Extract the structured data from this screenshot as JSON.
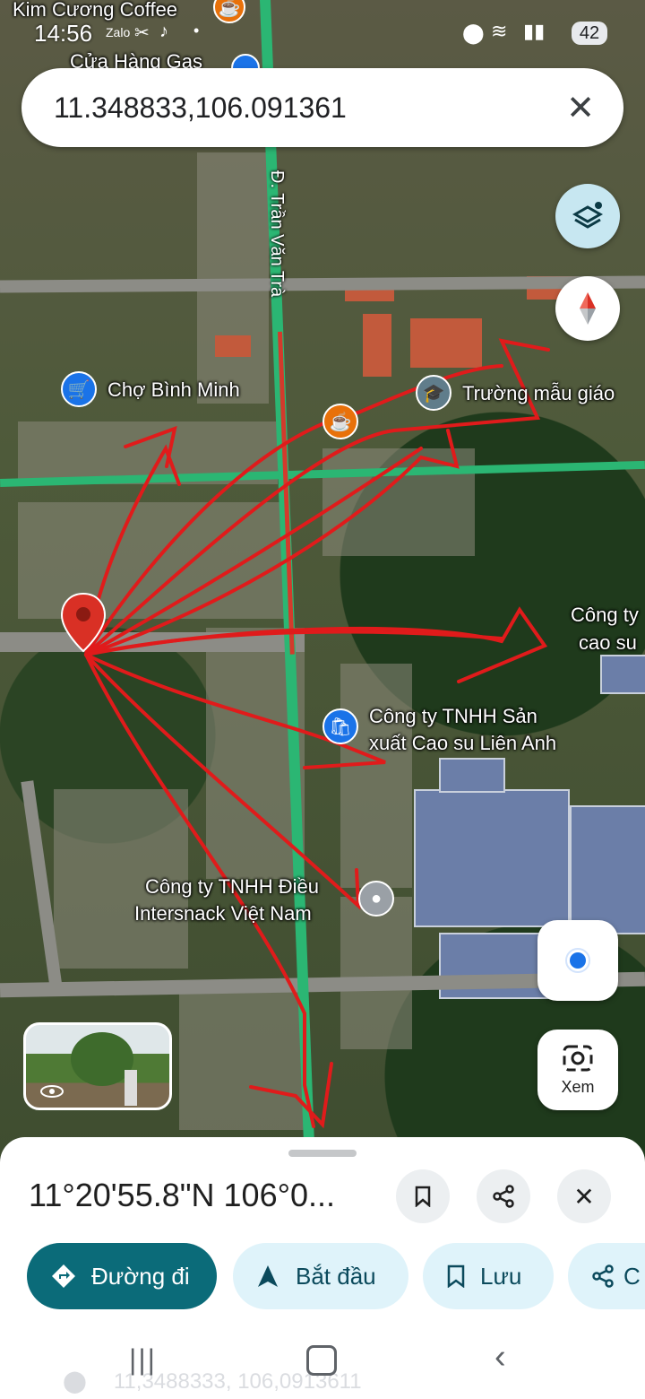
{
  "status_bar": {
    "time": "14:56",
    "battery": "42",
    "top_labels": [
      "Kim Cương Coffee",
      "Cửa Hàng Gas"
    ]
  },
  "search": {
    "value": "11.348833,106.091361"
  },
  "map": {
    "street": "Đ. Trần Văn Trà",
    "places": [
      "Chợ Bình Minh",
      "Trường mẫu giáo",
      "Công ty TNHH Sản xuất Cao su Liên Anh",
      "Công ty TNHH Điều Intersnack Việt Nam",
      "Công ty cao su"
    ],
    "place_lines": {
      "lienanh_1": "Công ty TNHH Sản",
      "lienanh_2": "xuất Cao su Liên Anh",
      "intersnack_1": "Công ty TNHH Điều",
      "intersnack_2": "Intersnack Việt Nam",
      "partial_1": "Công ty",
      "partial_2": "cao su"
    },
    "camera_label": "Xem",
    "icons": [
      "layers-icon",
      "compass-icon",
      "my-location-icon",
      "camera-search-icon",
      "street-view-thumbnail"
    ]
  },
  "sheet": {
    "title": "11°20'55.8\"N 106°0...",
    "chips": {
      "directions": "Đường đi",
      "start": "Bắt đầu",
      "save": "Lưu",
      "share": "C"
    },
    "footer_coords": "11,3488333, 106,0913611"
  },
  "colors": {
    "accent": "#0b6b79",
    "chip_bg": "#dff3fa",
    "pin": "#d93025",
    "sketch": "#e01b1b"
  }
}
